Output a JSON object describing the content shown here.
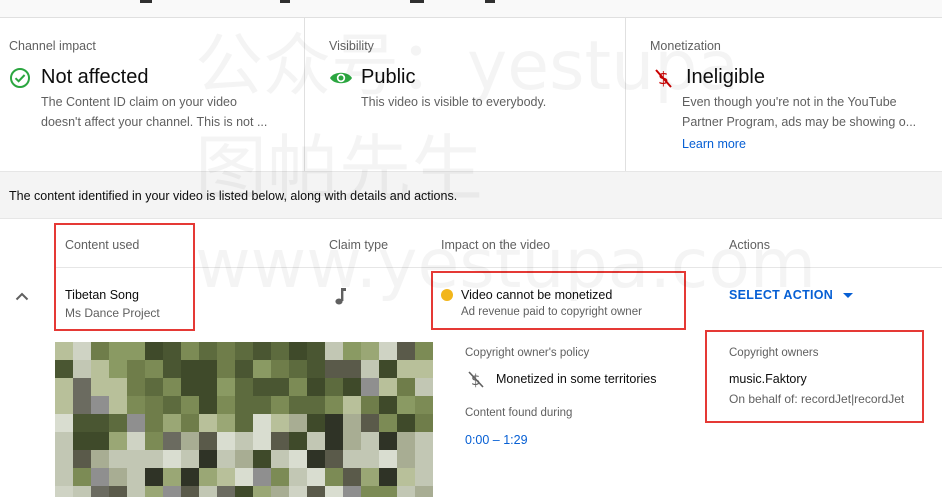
{
  "top_strip": {
    "text_fragments": [
      "",
      "",
      "",
      ""
    ]
  },
  "summary_cards": [
    {
      "caption": "Channel impact",
      "status": "Not affected",
      "icon": "check-circle-icon",
      "icon_color": "#2ba640",
      "description": [
        "The Content ID claim on your video",
        "doesn't affect your channel. This is not ..."
      ]
    },
    {
      "caption": "Visibility",
      "status": "Public",
      "icon": "eye-icon",
      "icon_color": "#2ba640",
      "description": [
        "This video is visible to everybody."
      ]
    },
    {
      "caption": "Monetization",
      "status": "Ineligible",
      "icon": "no-dollar-icon",
      "icon_color": "#cc0000",
      "description": [
        "Even though you're not in the YouTube",
        "Partner Program, ads may be showing o..."
      ],
      "link": "Learn more"
    }
  ],
  "banner_text": "The content identified in your video is listed below, along with details and actions.",
  "table": {
    "headers": {
      "content_used": "Content used",
      "claim_type": "Claim type",
      "impact": "Impact on the video",
      "actions": "Actions"
    },
    "row": {
      "song_title": "Tibetan Song",
      "song_artist": "Ms Dance Project",
      "claim_type_icon": "music-note-icon",
      "impact_title": "Video cannot be monetized",
      "impact_sub": "Ad revenue paid to copyright owner",
      "impact_color": "#f2b61b",
      "action_label": "SELECT ACTION"
    },
    "details": {
      "policy_caption": "Copyright owner's policy",
      "policy_value": "Monetized in some territories",
      "found_caption": "Content found during",
      "found_range": "0:00 – 1:29",
      "owners_caption": "Copyright owners",
      "owner_name": "music.Faktory",
      "owner_behalf": "On behalf of: recordJet|recordJet"
    }
  },
  "watermark": {
    "line1": "公众号：yestupa",
    "line2": "图帕先生",
    "line3": "www.yestupa.com"
  },
  "colors": {
    "accent_blue": "#065fd4",
    "highlight_red": "#e53935"
  }
}
